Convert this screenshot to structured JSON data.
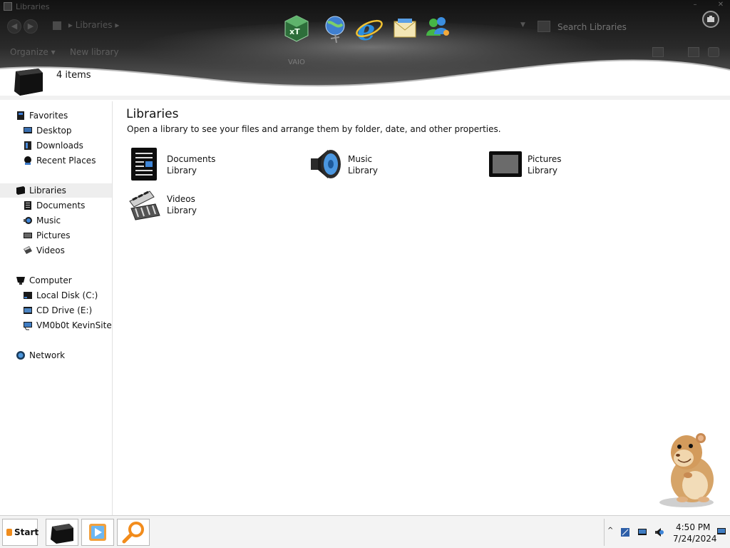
{
  "window": {
    "title": "Libraries",
    "minimize": "–",
    "close": "✕"
  },
  "address": {
    "breadcrumb_root": "▸",
    "breadcrumb": "Libraries",
    "breadcrumb_sep": "▸",
    "back": "◀",
    "forward": "▶"
  },
  "search": {
    "placeholder": "Search Libraries",
    "dropdown": "▼"
  },
  "toolbar": {
    "organize": "Organize ▾",
    "new_library": "New library"
  },
  "dock": {
    "label": "VAIO",
    "items": [
      "xtree-icon",
      "network-globe-icon",
      "internet-explorer-icon",
      "mail-icon",
      "messenger-icon"
    ]
  },
  "details": {
    "count": "4 items"
  },
  "navigation": {
    "favorites": {
      "label": "Favorites",
      "items": [
        {
          "label": "Desktop",
          "icon": "desktop-icon"
        },
        {
          "label": "Downloads",
          "icon": "downloads-icon"
        },
        {
          "label": "Recent Places",
          "icon": "recent-places-icon"
        }
      ]
    },
    "libraries": {
      "label": "Libraries",
      "items": [
        {
          "label": "Documents",
          "icon": "documents-icon"
        },
        {
          "label": "Music",
          "icon": "music-icon"
        },
        {
          "label": "Pictures",
          "icon": "pictures-icon"
        },
        {
          "label": "Videos",
          "icon": "videos-icon"
        }
      ]
    },
    "computer": {
      "label": "Computer",
      "items": [
        {
          "label": "Local Disk (C:)",
          "icon": "local-disk-icon"
        },
        {
          "label": "CD Drive (E:)",
          "icon": "cd-drive-icon"
        },
        {
          "label": "VM0b0t KevinSite",
          "icon": "network-drive-icon"
        }
      ]
    },
    "network": {
      "label": "Network"
    }
  },
  "content": {
    "title": "Libraries",
    "description": "Open a library to see your files and arrange them by folder, date, and other properties.",
    "libraries": [
      {
        "name": "Documents",
        "type": "Library",
        "icon": "documents-library-icon"
      },
      {
        "name": "Music",
        "type": "Library",
        "icon": "music-library-icon"
      },
      {
        "name": "Pictures",
        "type": "Library",
        "icon": "pictures-library-icon"
      },
      {
        "name": "Videos",
        "type": "Library",
        "icon": "videos-library-icon"
      }
    ]
  },
  "taskbar": {
    "start": "Start",
    "buttons": [
      "explorer-icon",
      "media-player-icon",
      "search-magnifier-icon"
    ],
    "tray_arrow": "^",
    "time": "4:50 PM",
    "date": "7/24/2024"
  },
  "colors": {
    "header_dark": "#0f0f0f",
    "header_mid": "#3a3a3a",
    "selected_bg": "#eeeeee",
    "taskbar_bg": "#f3f3f3"
  }
}
